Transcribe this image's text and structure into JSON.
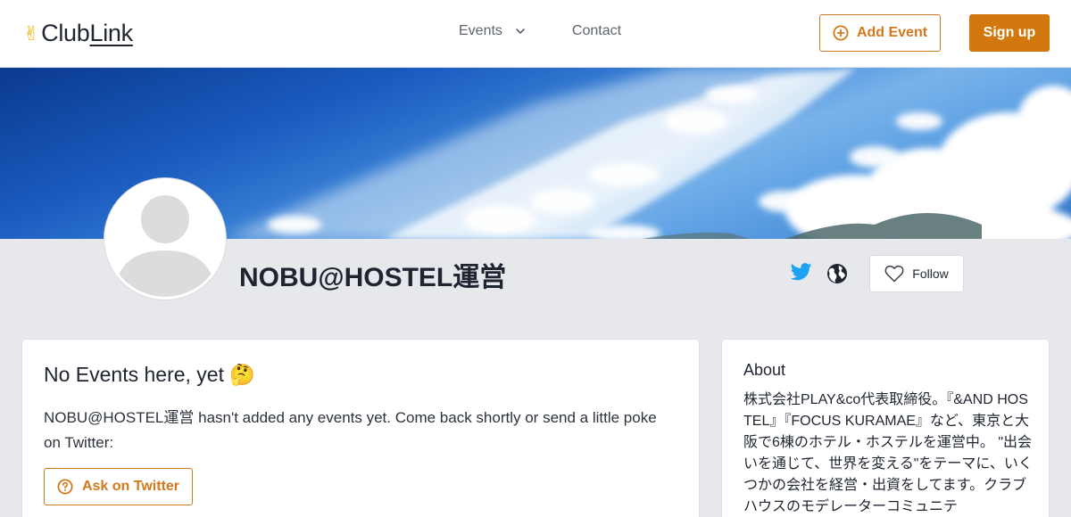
{
  "header": {
    "logo": {
      "hand": "✌",
      "club": "Club",
      "link": "Link"
    },
    "nav": {
      "events_label": "Events",
      "contact_label": "Contact"
    },
    "add_event_label": "Add Event",
    "signup_label": "Sign up"
  },
  "profile": {
    "name": "NOBU@HOSTEL運営",
    "follow_label": "Follow",
    "icons": [
      "twitter-icon",
      "globe-icon",
      "heart-icon"
    ]
  },
  "events_card": {
    "title": "No Events here, yet 🤔",
    "message": "NOBU@HOSTEL運営 hasn't added any events yet. Come back shortly or send a little poke on Twitter:",
    "ask_label": "Ask on Twitter"
  },
  "about_card": {
    "title": "About",
    "text": "株式会社PLAY&co代表取締役。『&AND HOSTEL』『FOCUS KURAMAE』など、東京と大阪で6棟のホテル・ホステルを運営中。 \"出会いを通じて、世界を変える\"をテーマに、いくつかの会社を経営・出資をしてます。クラブハウスのモデレーターコミュニテ"
  },
  "colors": {
    "accent": "#d2781d",
    "background": "#e7e8ec",
    "twitter": "#1da1f2"
  }
}
